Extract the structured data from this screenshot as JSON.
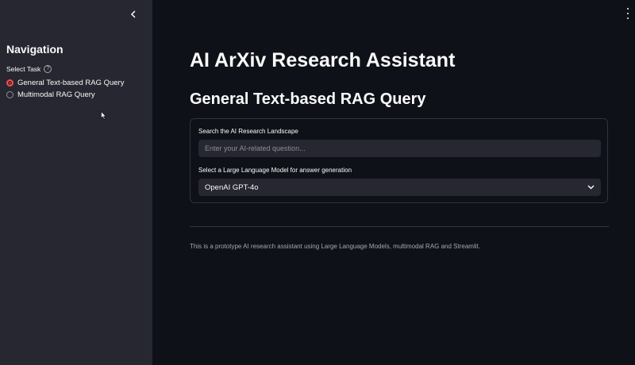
{
  "sidebar": {
    "title": "Navigation",
    "task_label": "Select Task",
    "help_icon": "question-circle-icon",
    "options": [
      {
        "label": "General Text-based RAG Query",
        "selected": true
      },
      {
        "label": "Multimodal RAG Query",
        "selected": false
      }
    ]
  },
  "main": {
    "title": "AI ArXiv Research Assistant",
    "subtitle": "General Text-based RAG Query",
    "search": {
      "label": "Search the AI Research Landscape",
      "placeholder": "Enter your AI-related question...",
      "value": ""
    },
    "model_select": {
      "label": "Select a Large Language Model for answer generation",
      "selected": "OpenAI GPT-4o"
    },
    "footer": "This is a prototype AI research assistant using Large Language Models, multimodal RAG and Streamlit."
  },
  "colors": {
    "background": "#0e1117",
    "sidebar": "#262730",
    "accent": "#ff4b4b",
    "input_bg": "#262730"
  }
}
